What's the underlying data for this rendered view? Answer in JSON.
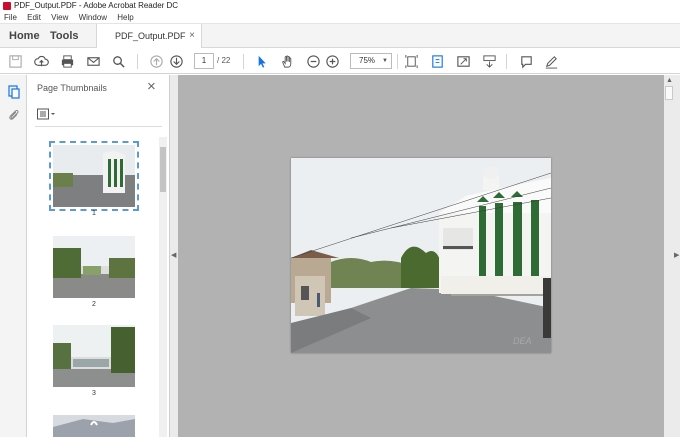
{
  "window": {
    "title": "PDF_Output.PDF - Adobe Acrobat Reader DC"
  },
  "menu": {
    "items": [
      "File",
      "Edit",
      "View",
      "Window",
      "Help"
    ]
  },
  "tabs": {
    "home": "Home",
    "tools": "Tools",
    "document": "PDF_Output.PDF",
    "close_glyph": "×"
  },
  "toolbar": {
    "icons": [
      "save-icon",
      "upload-icon",
      "print-icon",
      "email-icon",
      "search-icon",
      "page-up-icon",
      "page-down-icon",
      "select-cursor-icon",
      "hand-icon",
      "zoom-out-icon",
      "zoom-in-icon",
      "fit-page-icon",
      "scroll-mode-icon",
      "fullscreen-icon",
      "read-mode-icon",
      "comment-icon",
      "sign-icon"
    ],
    "current_page": "1",
    "total_pages": "/ 22",
    "zoom": "75%",
    "accent_color": "#1473e6"
  },
  "panel": {
    "title": "Page Thumbnails",
    "thumbnails": [
      {
        "label": "1",
        "selected": true
      },
      {
        "label": "2",
        "selected": false
      },
      {
        "label": "3",
        "selected": false
      }
    ]
  },
  "colors": {
    "doc_background": "#b2b2b2",
    "panel_background": "#ffffff"
  }
}
